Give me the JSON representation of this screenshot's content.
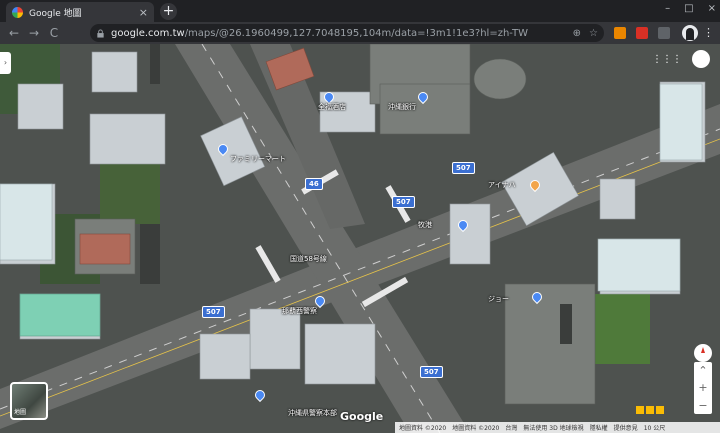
{
  "browser": {
    "tab_title": "Google 地圖",
    "tab_close": "×",
    "new_tab": "+",
    "url_host": "google.com.tw",
    "url_path": "/maps/@26.1960499,127.7048195,104m/data=!3m1!1e3?hl=zh-TW",
    "nav_back": "←",
    "nav_forward": "→",
    "nav_reload": "C",
    "win_min": "–",
    "win_max": "□",
    "win_close": "×",
    "menu": "⋮"
  },
  "map": {
    "labels": [
      {
        "text": "全福酒店"
      },
      {
        "text": "沖縄銀行"
      },
      {
        "text": "ファミリーマート"
      },
      {
        "text": "アイナハ"
      },
      {
        "text": "牧港"
      },
      {
        "text": "国道58号線"
      },
      {
        "text": "那覇西警察"
      },
      {
        "text": "ジョー"
      },
      {
        "text": "沖縄県警察本部"
      }
    ],
    "road_shields": [
      "507",
      "46",
      "507",
      "507",
      "507"
    ],
    "layer_label": "地圖",
    "logo": "Google",
    "apps_icon": "⋮⋮⋮",
    "zoom_in": "+",
    "zoom_out": "−",
    "expand": "⌃"
  },
  "footer": {
    "imagery": "地圖資料 ©2020",
    "map_data": "地圖資料 ©2020",
    "region": "台灣",
    "tos": "無法使用 3D 地球檢視",
    "privacy": "隱私權",
    "feedback": "提供意見",
    "scale": "10 公尺"
  },
  "colors": {
    "tab_bg": "#35363a",
    "frame_bg": "#202124",
    "road_shield": "#3b6fd1",
    "poi_blue": "#4a89f3",
    "poi_orange": "#f2a54a"
  }
}
